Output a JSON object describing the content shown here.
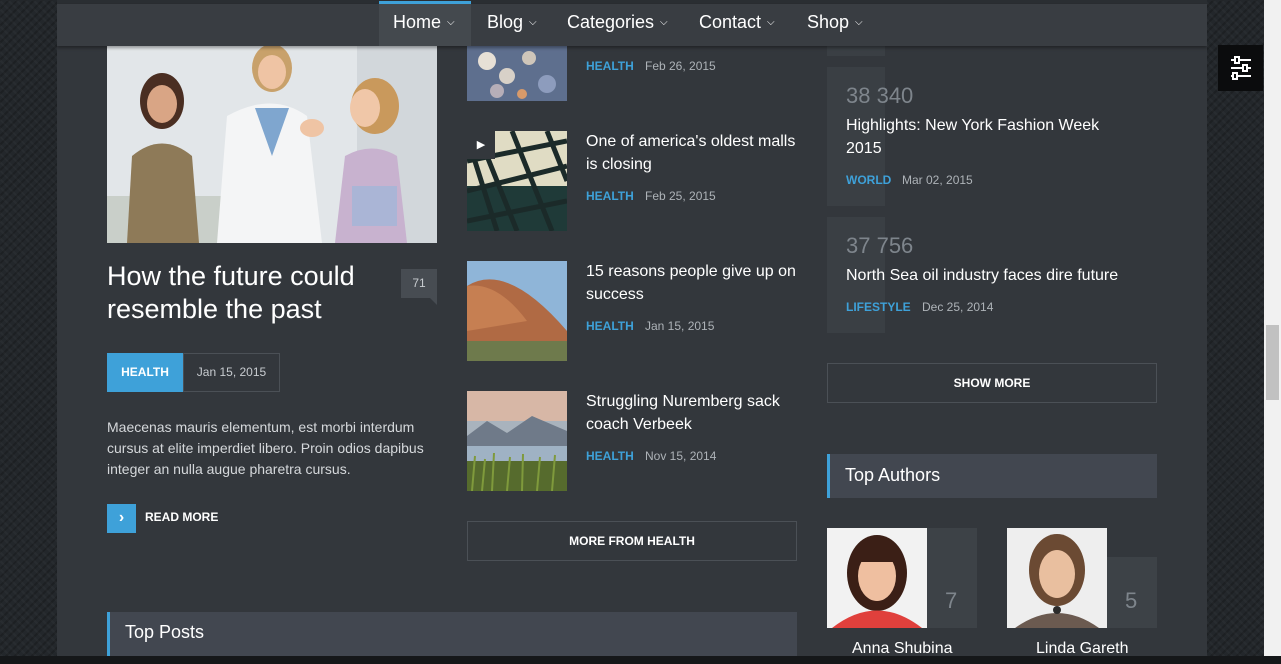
{
  "nav": {
    "items": [
      {
        "label": "Home"
      },
      {
        "label": "Blog"
      },
      {
        "label": "Categories"
      },
      {
        "label": "Contact"
      },
      {
        "label": "Shop"
      }
    ]
  },
  "featured": {
    "title": "How the future could resemble the past",
    "comments": "71",
    "category": "HEALTH",
    "date": "Jan 15, 2015",
    "excerpt": "Maecenas mauris elementum, est morbi interdum cursus at elite imperdiet libero. Proin odios dapibus integer an nulla augue pharetra cursus.",
    "read_more": "READ MORE"
  },
  "health_posts": [
    {
      "title": "",
      "category": "HEALTH",
      "date": "Feb 26, 2015"
    },
    {
      "title": "One of america's oldest malls is closing",
      "category": "HEALTH",
      "date": "Feb 25, 2015"
    },
    {
      "title": "15 reasons people give up on success",
      "category": "HEALTH",
      "date": "Jan 15, 2015"
    },
    {
      "title": "Struggling Nuremberg sack coach Verbeek",
      "category": "HEALTH",
      "date": "Nov 15, 2014"
    }
  ],
  "more_from_health": "MORE FROM HEALTH",
  "ranked_posts": [
    {
      "count": "38 340",
      "title": "Highlights: New York Fashion Week 2015",
      "category": "WORLD",
      "date": "Mar 02, 2015"
    },
    {
      "count": "37 756",
      "title": "North Sea oil industry faces dire future",
      "category": "LIFESTYLE",
      "date": "Dec 25, 2014"
    }
  ],
  "show_more": "SHOW MORE",
  "top_authors": {
    "heading": "Top Authors",
    "authors": [
      {
        "name": "Anna Shubina",
        "count": "7"
      },
      {
        "name": "Linda Gareth",
        "count": "5"
      }
    ]
  },
  "top_posts": {
    "heading": "Top Posts"
  },
  "colors": {
    "accent": "#3ea1d9",
    "panel": "#33373c",
    "nav": "#393d42"
  },
  "icons": [
    "chevron-down-icon",
    "chevron-right-icon",
    "play-icon",
    "settings-sliders-icon"
  ]
}
